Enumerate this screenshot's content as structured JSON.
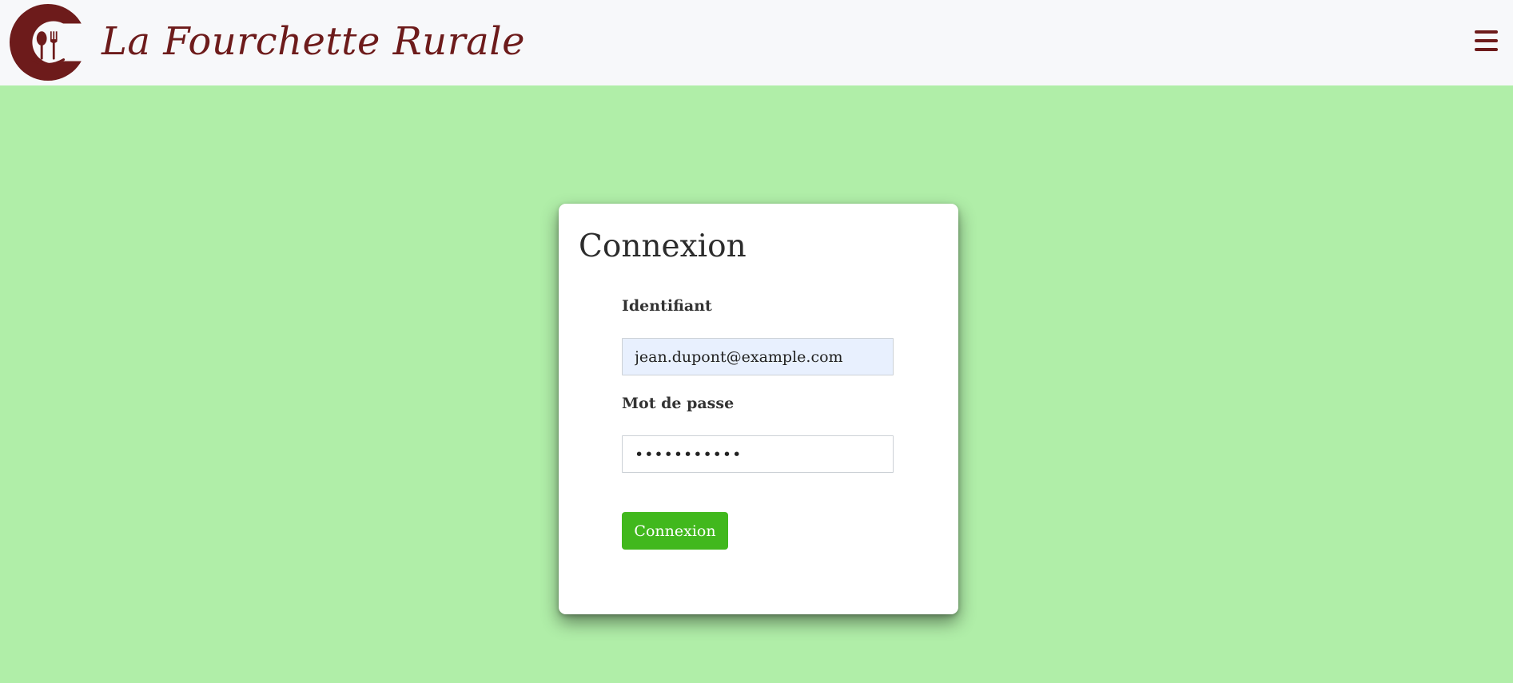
{
  "app": {
    "brand_name": "La Fourchette Rurale",
    "brand_color": "#6d1b1b",
    "logo_icon": "fork-spoon-plate-logo"
  },
  "header": {
    "menu_icon": "hamburger-menu-icon"
  },
  "login": {
    "title": "Connexion",
    "username_label": "Identifiant",
    "username_value": "jean.dupont@example.com",
    "password_label": "Mot de passe",
    "password_value": "•••••••••••",
    "submit_label": "Connexion"
  },
  "colors": {
    "page_background": "#b0eea8",
    "header_background": "#f7f8fa",
    "button_background": "#41b81d",
    "autofill_background": "#e8f0fe"
  }
}
